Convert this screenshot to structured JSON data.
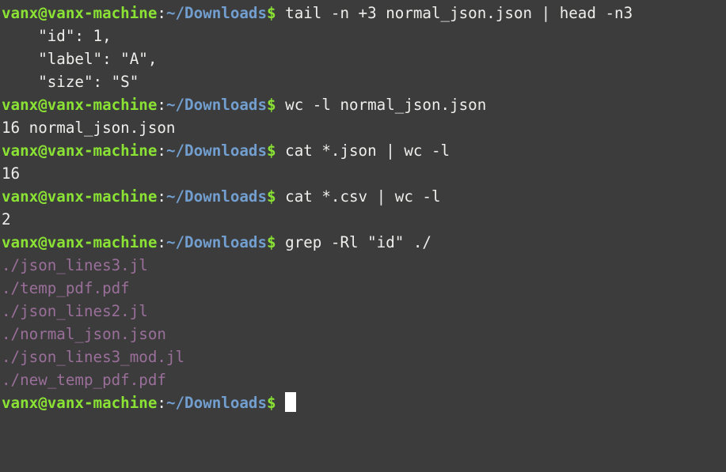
{
  "terminal": {
    "background_color": "#3c3c3c",
    "foreground_color": "#eeeeec",
    "prompt_user_color": "#8ae234",
    "prompt_path_color": "#729fcf",
    "grep_match_color": "#9a6f9a",
    "cursor_color": "#ffffff",
    "prompt": {
      "userhost": "vanx@vanx-machine",
      "separator": ":",
      "path": "~/Downloads",
      "sigil": "$"
    },
    "lines": [
      {
        "type": "prompt",
        "command": " tail -n +3 normal_json.json | head -n3"
      },
      {
        "type": "output",
        "text": "    \"id\": 1,"
      },
      {
        "type": "output",
        "text": "    \"label\": \"A\","
      },
      {
        "type": "output",
        "text": "    \"size\": \"S\""
      },
      {
        "type": "prompt",
        "command": " wc -l normal_json.json"
      },
      {
        "type": "output",
        "text": "16 normal_json.json"
      },
      {
        "type": "prompt",
        "command": " cat *.json | wc -l"
      },
      {
        "type": "output",
        "text": "16"
      },
      {
        "type": "prompt",
        "command": " cat *.csv | wc -l"
      },
      {
        "type": "output",
        "text": "2"
      },
      {
        "type": "prompt",
        "command": " grep -Rl \"id\" ./"
      },
      {
        "type": "grep",
        "text": "./json_lines3.jl"
      },
      {
        "type": "grep",
        "text": "./temp_pdf.pdf"
      },
      {
        "type": "grep",
        "text": "./json_lines2.jl"
      },
      {
        "type": "grep",
        "text": "./normal_json.json"
      },
      {
        "type": "grep",
        "text": "./json_lines3_mod.jl"
      },
      {
        "type": "grep",
        "text": "./new_temp_pdf.pdf"
      },
      {
        "type": "prompt-cursor",
        "command": " "
      }
    ]
  }
}
